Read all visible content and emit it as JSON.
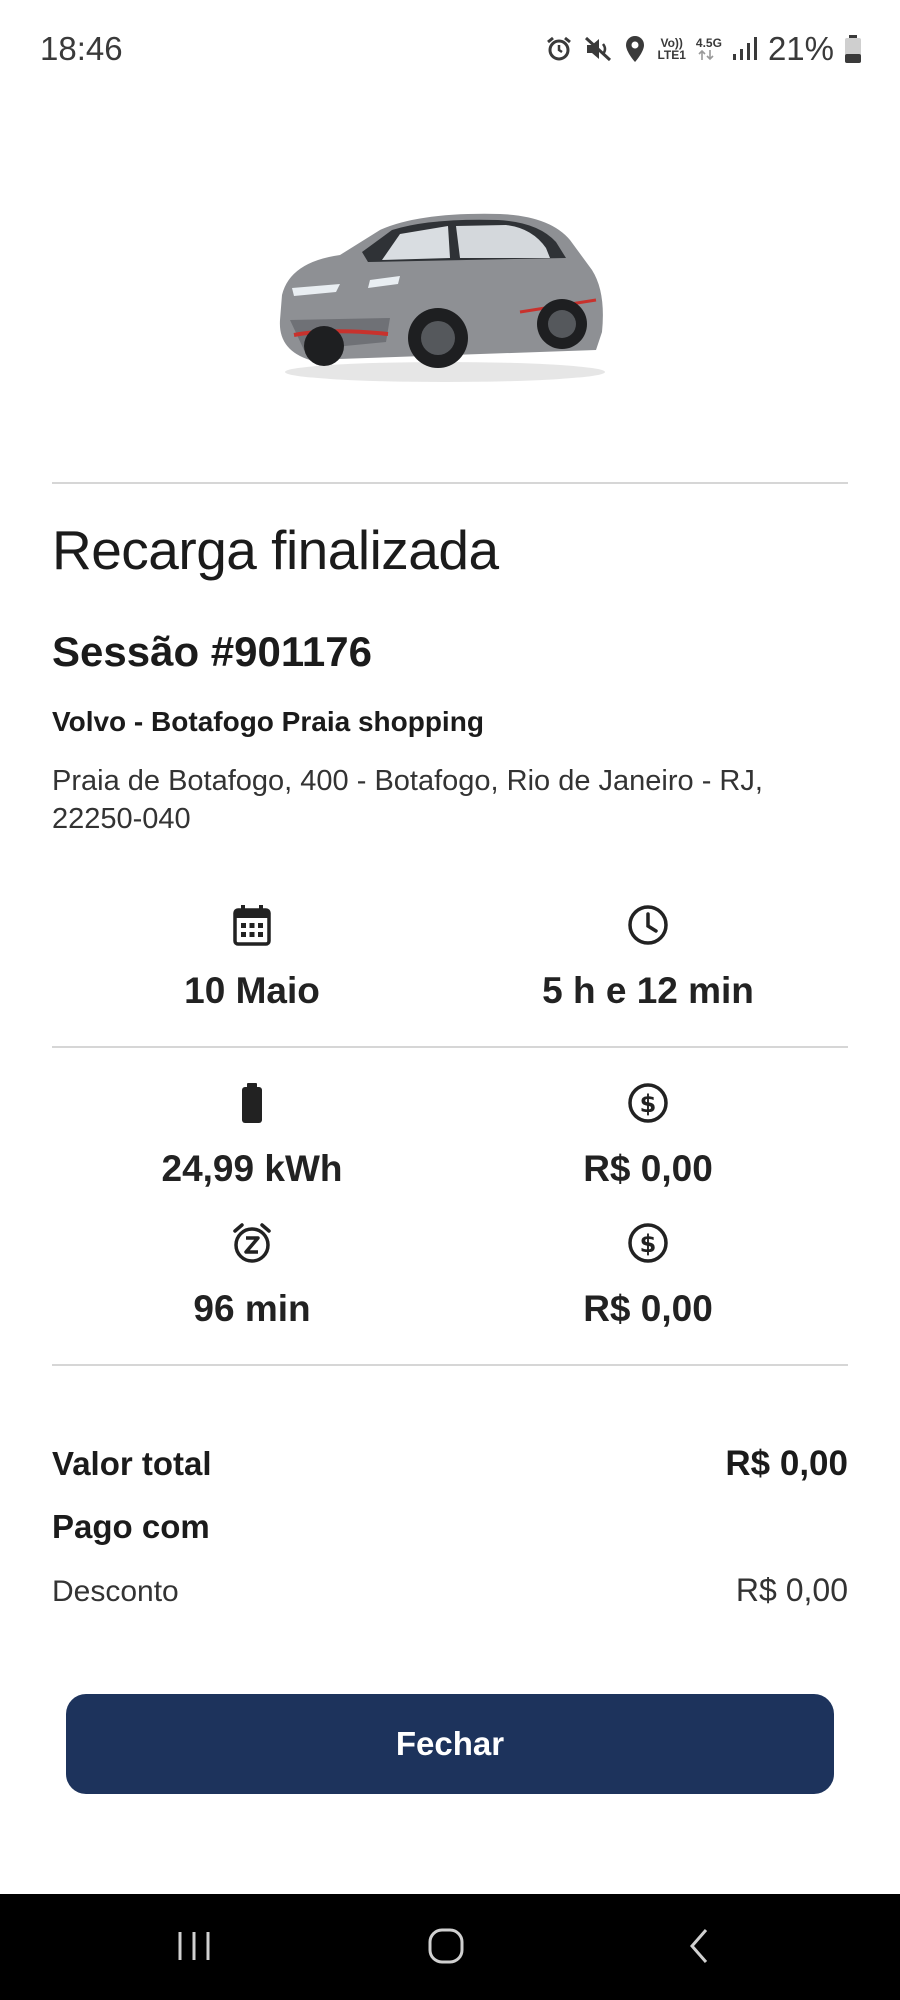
{
  "status_bar": {
    "time": "18:46",
    "network_label_top": "Vo))",
    "network_label_bottom": "LTE1",
    "data_label": "4.5G",
    "battery_percent": "21%",
    "icons": [
      "alarm-icon",
      "mute-icon",
      "location-icon",
      "signal-icon",
      "battery-icon"
    ]
  },
  "page": {
    "title": "Recarga finalizada",
    "session": "Sessão #901176",
    "station_name": "Volvo - Botafogo Praia shopping",
    "address": "Praia de Botafogo, 400 - Botafogo, Rio de Janeiro - RJ, 22250-040"
  },
  "details": {
    "date": "10 Maio",
    "duration": "5 h e 12 min",
    "energy": "24,99 kWh",
    "energy_cost": "R$ 0,00",
    "idle_time": "96 min",
    "idle_cost": "R$ 0,00"
  },
  "summary": {
    "total_label": "Valor total",
    "total_value": "R$ 0,00",
    "paid_with_label": "Pago com",
    "discount_label": "Desconto",
    "discount_value": "R$ 0,00"
  },
  "actions": {
    "close_label": "Fechar"
  },
  "colors": {
    "primary_button": "#1d335c",
    "divider": "#d6d6d6",
    "nav_bar": "#000000"
  }
}
